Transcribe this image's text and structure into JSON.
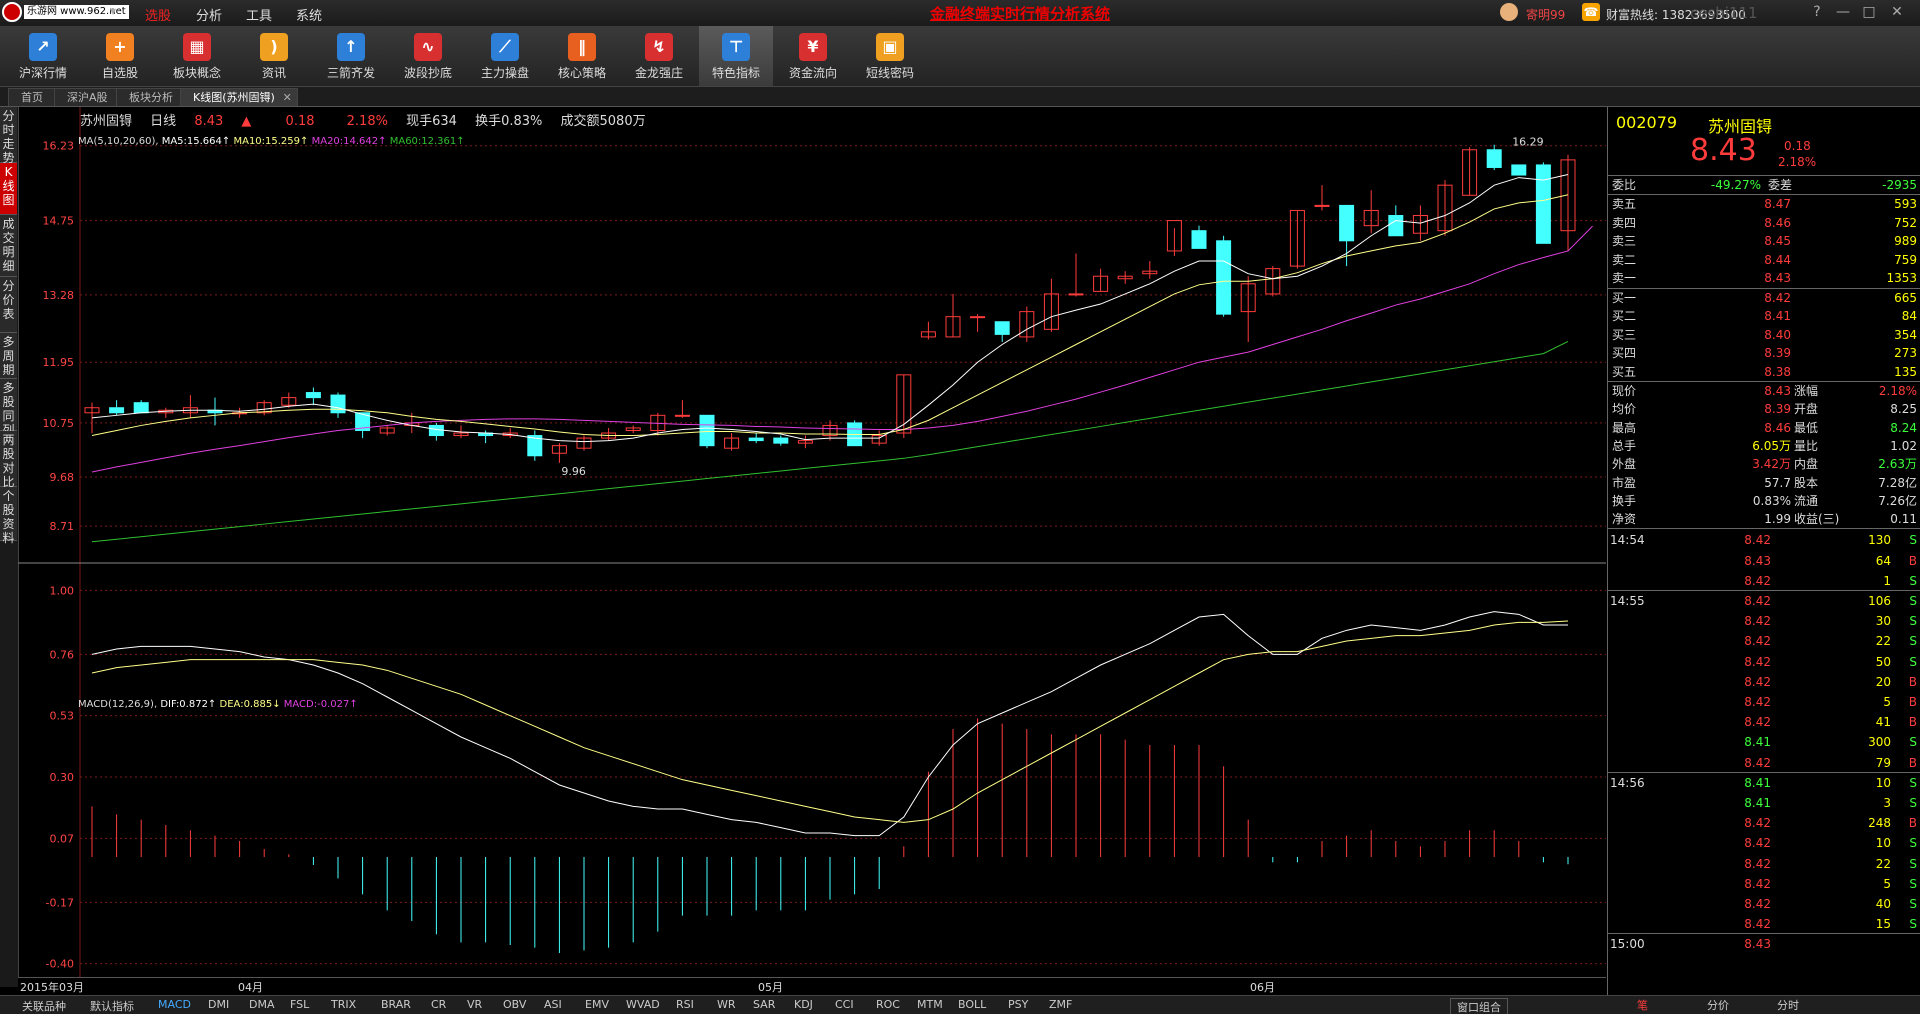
{
  "titlebar": {
    "logo_tag": "乐游网 www.962.net",
    "menus": [
      "选股",
      "分析",
      "工具",
      "系统"
    ],
    "marquee": "金融终端实时行情分析系统",
    "user_name": "寄明99",
    "hotline": "财富热线: 13823693500",
    "watermark": "ceshi111",
    "win_buttons": [
      "?",
      "—",
      "□",
      "✕"
    ]
  },
  "toolbar": [
    {
      "label": "沪深行情",
      "icon": "chart-icon",
      "color": "#2d7fd8",
      "glyph": "↗"
    },
    {
      "label": "自选股",
      "icon": "plus-icon",
      "color": "#f08020",
      "glyph": "+"
    },
    {
      "label": "板块概念",
      "icon": "grid-icon",
      "color": "#d83030",
      "glyph": "▦"
    },
    {
      "label": "资讯",
      "icon": "rss-icon",
      "color": "#f0a020",
      "glyph": ")"
    },
    {
      "label": "三箭齐发",
      "icon": "arrows-icon",
      "color": "#2d7fd8",
      "glyph": "↑"
    },
    {
      "label": "波段抄底",
      "icon": "wave-icon",
      "color": "#d83030",
      "glyph": "∿"
    },
    {
      "label": "主力操盘",
      "icon": "line-chart-icon",
      "color": "#2d7fd8",
      "glyph": "⟋"
    },
    {
      "label": "核心策略",
      "icon": "candle-icon",
      "color": "#e86020",
      "glyph": "‖"
    },
    {
      "label": "金龙强庄",
      "icon": "trend-icon",
      "color": "#d83030",
      "glyph": "↯"
    },
    {
      "label": "特色指标",
      "icon": "signpost-icon",
      "color": "#2d7fd8",
      "glyph": "⊤"
    },
    {
      "label": "资金流向",
      "icon": "money-icon",
      "color": "#d83030",
      "glyph": "¥"
    },
    {
      "label": "短线密码",
      "icon": "lock-icon",
      "color": "#f0a020",
      "glyph": "▣"
    }
  ],
  "tabs": [
    "首页",
    "深沪A股",
    "板块分析",
    "K线图(苏州固锝)"
  ],
  "sidebar": [
    "分时走势",
    "K线图",
    "成交明细",
    "分价表",
    "多周期",
    "多股同列",
    "两股对比",
    "个股资料"
  ],
  "stock": {
    "name": "苏州固锝",
    "period": "日线",
    "price": "8.43",
    "arrow": "▲",
    "change": "0.18",
    "pct": "2.18%",
    "volume_label": "现手634",
    "turnover_label": "换手0.83%",
    "amount_label": "成交额5080万"
  },
  "ma_legend": {
    "title": "MA(5,10,20,60)",
    "ma5": "MA5:15.664↑",
    "ma10": "MA10:15.259↑",
    "ma20": "MA20:14.642↑",
    "ma60": "MA60:12.361↑"
  },
  "macd_legend": {
    "title": "MACD(12,26,9)",
    "dif": "DIF:0.872↑",
    "dea": "DEA:0.885↓",
    "macd": "MACD:-0.027↑"
  },
  "colors": {
    "up": "#ff3c3c",
    "down": "#4ff",
    "ma5": "#ffffff",
    "ma10": "#ffff88",
    "ma20": "#e040e0",
    "ma60": "#30c030",
    "grid": "#7a1a1a"
  },
  "chart_data": [
    {
      "type": "candlestick",
      "title": "苏州固锝 日线",
      "y_ticks": [
        "16.23",
        "14.75",
        "13.28",
        "11.95",
        "10.75",
        "9.68",
        "8.71"
      ],
      "ylim": [
        8.0,
        16.6
      ],
      "annotations": [
        "16.29",
        "9.96"
      ],
      "candles": [
        [
          10.95,
          11.15,
          10.55,
          11.05
        ],
        [
          11.05,
          11.2,
          10.9,
          10.95
        ],
        [
          11.15,
          11.2,
          10.95,
          10.95
        ],
        [
          10.95,
          11.05,
          10.85,
          11.0
        ],
        [
          10.95,
          11.3,
          10.85,
          11.05
        ],
        [
          11.0,
          11.25,
          10.7,
          10.95
        ],
        [
          10.95,
          11.05,
          10.85,
          10.95
        ],
        [
          10.95,
          11.2,
          10.9,
          11.15
        ],
        [
          11.1,
          11.35,
          11.05,
          11.25
        ],
        [
          11.35,
          11.45,
          11.1,
          11.25
        ],
        [
          11.3,
          11.35,
          10.85,
          10.95
        ],
        [
          10.95,
          10.95,
          10.45,
          10.6
        ],
        [
          10.55,
          10.7,
          10.5,
          10.65
        ],
        [
          10.7,
          10.95,
          10.55,
          10.75
        ],
        [
          10.7,
          10.75,
          10.4,
          10.5
        ],
        [
          10.5,
          10.7,
          10.45,
          10.55
        ],
        [
          10.55,
          10.6,
          10.35,
          10.5
        ],
        [
          10.5,
          10.65,
          10.45,
          10.55
        ],
        [
          10.5,
          10.6,
          10.0,
          10.1
        ],
        [
          10.15,
          10.35,
          9.96,
          10.3
        ],
        [
          10.25,
          10.5,
          10.2,
          10.45
        ],
        [
          10.45,
          10.65,
          10.4,
          10.55
        ],
        [
          10.6,
          10.7,
          10.55,
          10.65
        ],
        [
          10.6,
          10.95,
          10.5,
          10.9
        ],
        [
          10.9,
          11.2,
          10.85,
          10.9
        ],
        [
          10.9,
          10.9,
          10.25,
          10.3
        ],
        [
          10.25,
          10.55,
          10.2,
          10.45
        ],
        [
          10.45,
          10.55,
          10.35,
          10.4
        ],
        [
          10.45,
          10.5,
          10.3,
          10.35
        ],
        [
          10.35,
          10.5,
          10.25,
          10.4
        ],
        [
          10.5,
          10.8,
          10.4,
          10.7
        ],
        [
          10.75,
          10.8,
          10.3,
          10.3
        ],
        [
          10.35,
          10.6,
          10.3,
          10.5
        ],
        [
          10.55,
          11.7,
          10.45,
          11.7
        ],
        [
          12.45,
          12.75,
          12.4,
          12.55
        ],
        [
          12.45,
          13.3,
          12.45,
          12.85
        ],
        [
          12.85,
          12.9,
          12.55,
          12.85
        ],
        [
          12.75,
          12.75,
          12.35,
          12.5
        ],
        [
          12.45,
          13.05,
          12.35,
          12.95
        ],
        [
          12.6,
          13.6,
          12.55,
          13.3
        ],
        [
          13.3,
          14.1,
          13.25,
          13.3
        ],
        [
          13.35,
          13.8,
          13.35,
          13.65
        ],
        [
          13.6,
          13.75,
          13.5,
          13.65
        ],
        [
          13.7,
          13.95,
          13.6,
          13.75
        ],
        [
          14.15,
          14.6,
          14.05,
          14.75
        ],
        [
          14.55,
          14.65,
          14.25,
          14.2
        ],
        [
          14.35,
          14.45,
          12.85,
          12.9
        ],
        [
          12.95,
          13.65,
          12.35,
          13.5
        ],
        [
          13.3,
          13.85,
          13.25,
          13.8
        ],
        [
          13.85,
          14.95,
          13.8,
          14.95
        ],
        [
          15.05,
          15.45,
          14.95,
          15.05
        ],
        [
          15.05,
          15.05,
          13.85,
          14.35
        ],
        [
          14.65,
          15.35,
          14.5,
          14.95
        ],
        [
          14.85,
          15.05,
          14.45,
          14.45
        ],
        [
          14.5,
          15.05,
          14.35,
          14.85
        ],
        [
          14.55,
          15.55,
          14.45,
          15.45
        ],
        [
          15.25,
          16.2,
          15.25,
          16.15
        ],
        [
          16.15,
          16.25,
          15.75,
          15.8
        ],
        [
          15.85,
          15.85,
          15.65,
          15.65
        ],
        [
          15.85,
          15.9,
          14.35,
          14.3
        ],
        [
          14.55,
          16.05,
          14.15,
          15.95
        ]
      ],
      "ma5": [
        10.85,
        10.9,
        10.95,
        10.98,
        11.0,
        11.0,
        10.98,
        11.02,
        11.08,
        11.12,
        11.05,
        10.92,
        10.8,
        10.7,
        10.62,
        10.57,
        10.55,
        10.52,
        10.45,
        10.4,
        10.38,
        10.4,
        10.45,
        10.55,
        10.62,
        10.65,
        10.62,
        10.58,
        10.53,
        10.42,
        10.45,
        10.45,
        10.45,
        10.72,
        11.1,
        11.5,
        11.95,
        12.3,
        12.6,
        12.85,
        12.98,
        13.1,
        13.3,
        13.5,
        13.75,
        13.95,
        13.95,
        13.7,
        13.6,
        13.65,
        13.85,
        14.1,
        14.45,
        14.75,
        14.7,
        14.85,
        15.1,
        15.45,
        15.6,
        15.55,
        15.66
      ],
      "ma10": [
        10.5,
        10.6,
        10.7,
        10.78,
        10.85,
        10.9,
        10.95,
        10.97,
        11.0,
        11.02,
        11.02,
        10.99,
        10.95,
        10.88,
        10.82,
        10.78,
        10.73,
        10.68,
        10.63,
        10.57,
        10.52,
        10.5,
        10.5,
        10.52,
        10.55,
        10.58,
        10.58,
        10.55,
        10.55,
        10.53,
        10.53,
        10.52,
        10.52,
        10.62,
        10.8,
        11.05,
        11.3,
        11.55,
        11.8,
        12.05,
        12.3,
        12.55,
        12.8,
        13.05,
        13.3,
        13.48,
        13.55,
        13.55,
        13.6,
        13.72,
        13.9,
        14.05,
        14.15,
        14.25,
        14.32,
        14.5,
        14.72,
        14.98,
        15.1,
        15.15,
        15.26
      ],
      "ma20": [
        9.78,
        9.88,
        9.97,
        10.06,
        10.15,
        10.23,
        10.3,
        10.38,
        10.46,
        10.53,
        10.6,
        10.65,
        10.7,
        10.75,
        10.78,
        10.8,
        10.82,
        10.83,
        10.83,
        10.82,
        10.8,
        10.78,
        10.76,
        10.74,
        10.72,
        10.71,
        10.7,
        10.68,
        10.67,
        10.65,
        10.64,
        10.63,
        10.62,
        10.62,
        10.65,
        10.7,
        10.78,
        10.88,
        10.98,
        11.1,
        11.22,
        11.36,
        11.5,
        11.65,
        11.8,
        11.95,
        12.05,
        12.15,
        12.3,
        12.45,
        12.6,
        12.77,
        12.92,
        13.08,
        13.2,
        13.35,
        13.5,
        13.7,
        13.88,
        14.02,
        14.15,
        14.64
      ],
      "ma60": [
        8.4,
        8.45,
        8.5,
        8.55,
        8.6,
        8.65,
        8.7,
        8.75,
        8.8,
        8.85,
        8.9,
        8.95,
        9.0,
        9.05,
        9.1,
        9.15,
        9.2,
        9.25,
        9.3,
        9.35,
        9.4,
        9.45,
        9.5,
        9.55,
        9.6,
        9.65,
        9.7,
        9.75,
        9.8,
        9.85,
        9.9,
        9.95,
        10.0,
        10.05,
        10.12,
        10.2,
        10.28,
        10.36,
        10.44,
        10.52,
        10.6,
        10.68,
        10.76,
        10.84,
        10.92,
        11.0,
        11.08,
        11.16,
        11.24,
        11.32,
        11.4,
        11.48,
        11.56,
        11.64,
        11.72,
        11.8,
        11.88,
        11.96,
        12.04,
        12.12,
        12.36
      ]
    },
    {
      "type": "bar",
      "title": "MACD(12,26,9)",
      "y_ticks": [
        "1.00",
        "0.76",
        "0.53",
        "0.30",
        "0.07",
        "-0.17",
        "-0.40"
      ],
      "ylim": [
        -0.45,
        1.05
      ],
      "dif": [
        0.76,
        0.78,
        0.79,
        0.79,
        0.79,
        0.78,
        0.77,
        0.75,
        0.74,
        0.72,
        0.69,
        0.65,
        0.6,
        0.55,
        0.5,
        0.45,
        0.41,
        0.37,
        0.32,
        0.27,
        0.24,
        0.21,
        0.19,
        0.18,
        0.18,
        0.16,
        0.14,
        0.13,
        0.11,
        0.09,
        0.09,
        0.08,
        0.08,
        0.15,
        0.3,
        0.42,
        0.5,
        0.54,
        0.58,
        0.62,
        0.67,
        0.72,
        0.76,
        0.8,
        0.85,
        0.9,
        0.91,
        0.83,
        0.76,
        0.76,
        0.82,
        0.85,
        0.87,
        0.86,
        0.85,
        0.87,
        0.9,
        0.92,
        0.91,
        0.87,
        0.87
      ],
      "dea": [
        0.69,
        0.71,
        0.72,
        0.73,
        0.74,
        0.74,
        0.74,
        0.74,
        0.74,
        0.74,
        0.73,
        0.72,
        0.7,
        0.67,
        0.64,
        0.61,
        0.57,
        0.53,
        0.49,
        0.45,
        0.41,
        0.38,
        0.35,
        0.32,
        0.29,
        0.27,
        0.25,
        0.23,
        0.21,
        0.19,
        0.17,
        0.15,
        0.14,
        0.13,
        0.14,
        0.18,
        0.24,
        0.29,
        0.34,
        0.39,
        0.44,
        0.49,
        0.54,
        0.59,
        0.64,
        0.69,
        0.74,
        0.76,
        0.77,
        0.77,
        0.79,
        0.81,
        0.82,
        0.83,
        0.83,
        0.84,
        0.85,
        0.87,
        0.88,
        0.88,
        0.885
      ],
      "macd": [
        0.19,
        0.16,
        0.14,
        0.12,
        0.1,
        0.08,
        0.06,
        0.03,
        0.01,
        -0.03,
        -0.08,
        -0.14,
        -0.2,
        -0.24,
        -0.29,
        -0.32,
        -0.32,
        -0.33,
        -0.34,
        -0.36,
        -0.35,
        -0.34,
        -0.32,
        -0.28,
        -0.22,
        -0.22,
        -0.22,
        -0.2,
        -0.2,
        -0.2,
        -0.16,
        -0.14,
        -0.12,
        0.04,
        0.32,
        0.48,
        0.52,
        0.5,
        0.48,
        0.46,
        0.46,
        0.46,
        0.44,
        0.42,
        0.42,
        0.42,
        0.34,
        0.14,
        -0.02,
        -0.02,
        0.06,
        0.08,
        0.1,
        0.06,
        0.04,
        0.06,
        0.1,
        0.1,
        0.06,
        -0.02,
        -0.027
      ]
    }
  ],
  "date_axis": [
    "2015年03月",
    "04月",
    "05月",
    "06月"
  ],
  "bottom_tabs": [
    "关联品种",
    "默认指标",
    "MACD",
    "DMI",
    "DMA",
    "FSL",
    "TRIX",
    "BRAR",
    "CR",
    "VR",
    "OBV",
    "ASI",
    "EMV",
    "WVAD",
    "RSI",
    "WR",
    "SAR",
    "KDJ",
    "CCI",
    "ROC",
    "MTM",
    "BOLL",
    "PSY",
    "ZMF"
  ],
  "window_combo": "窗口组合",
  "right_panel": {
    "code": "002079",
    "name": "苏州固锝",
    "price": "8.43",
    "change": "0.18",
    "pct": "2.18%",
    "weibi": {
      "label": "委比",
      "value": "-49.27%",
      "label2": "委差",
      "value2": "-2935"
    },
    "asks": [
      {
        "label": "卖五",
        "price": "8.47",
        "vol": "593"
      },
      {
        "label": "卖四",
        "price": "8.46",
        "vol": "752"
      },
      {
        "label": "卖三",
        "price": "8.45",
        "vol": "989"
      },
      {
        "label": "卖二",
        "price": "8.44",
        "vol": "759"
      },
      {
        "label": "卖一",
        "price": "8.43",
        "vol": "1353"
      }
    ],
    "bids": [
      {
        "label": "买一",
        "price": "8.42",
        "vol": "665"
      },
      {
        "label": "买二",
        "price": "8.41",
        "vol": "84"
      },
      {
        "label": "买三",
        "price": "8.40",
        "vol": "354"
      },
      {
        "label": "买四",
        "price": "8.39",
        "vol": "273"
      },
      {
        "label": "买五",
        "price": "8.38",
        "vol": "135"
      }
    ],
    "stats": [
      {
        "l1": "现价",
        "v1": "8.43",
        "c1": "red",
        "l2": "涨幅",
        "v2": "2.18%",
        "c2": "red"
      },
      {
        "l1": "均价",
        "v1": "8.39",
        "c1": "red",
        "l2": "开盘",
        "v2": "8.25",
        "c2": "white"
      },
      {
        "l1": "最高",
        "v1": "8.46",
        "c1": "red",
        "l2": "最低",
        "v2": "8.24",
        "c2": "green"
      },
      {
        "l1": "总手",
        "v1": "6.05万",
        "c1": "yellow",
        "l2": "量比",
        "v2": "1.02",
        "c2": "white"
      },
      {
        "l1": "外盘",
        "v1": "3.42万",
        "c1": "red",
        "l2": "内盘",
        "v2": "2.63万",
        "c2": "green"
      },
      {
        "l1": "市盈",
        "v1": "57.7",
        "c1": "white",
        "l2": "股本",
        "v2": "7.28亿",
        "c2": "white"
      },
      {
        "l1": "换手",
        "v1": "0.83%",
        "c1": "white",
        "l2": "流通",
        "v2": "7.26亿",
        "c2": "white"
      },
      {
        "l1": "净资",
        "v1": "1.99",
        "c1": "white",
        "l2": "收益(三)",
        "v2": "0.11",
        "c2": "white"
      }
    ],
    "ticks": [
      {
        "t": "14:54",
        "p": "8.42",
        "v": "130",
        "d": "S"
      },
      {
        "t": "",
        "p": "8.43",
        "v": "64",
        "d": "B"
      },
      {
        "t": "",
        "p": "8.42",
        "v": "1",
        "d": "S"
      },
      {
        "t": "14:55",
        "p": "8.42",
        "v": "106",
        "d": "S"
      },
      {
        "t": "",
        "p": "8.42",
        "v": "30",
        "d": "S"
      },
      {
        "t": "",
        "p": "8.42",
        "v": "22",
        "d": "S"
      },
      {
        "t": "",
        "p": "8.42",
        "v": "50",
        "d": "S"
      },
      {
        "t": "",
        "p": "8.42",
        "v": "20",
        "d": "B"
      },
      {
        "t": "",
        "p": "8.42",
        "v": "5",
        "d": "B"
      },
      {
        "t": "",
        "p": "8.42",
        "v": "41",
        "d": "B"
      },
      {
        "t": "",
        "p": "8.41",
        "v": "300",
        "d": "S"
      },
      {
        "t": "",
        "p": "8.42",
        "v": "79",
        "d": "B"
      },
      {
        "t": "14:56",
        "p": "8.41",
        "v": "10",
        "d": "S"
      },
      {
        "t": "",
        "p": "8.41",
        "v": "3",
        "d": "S"
      },
      {
        "t": "",
        "p": "8.42",
        "v": "248",
        "d": "B"
      },
      {
        "t": "",
        "p": "8.42",
        "v": "10",
        "d": "S"
      },
      {
        "t": "",
        "p": "8.42",
        "v": "22",
        "d": "S"
      },
      {
        "t": "",
        "p": "8.42",
        "v": "5",
        "d": "S"
      },
      {
        "t": "",
        "p": "8.42",
        "v": "40",
        "d": "S"
      },
      {
        "t": "",
        "p": "8.42",
        "v": "15",
        "d": "S"
      },
      {
        "t": "15:00",
        "p": "8.43",
        "v": "",
        "d": ""
      }
    ],
    "bottom_tabs": [
      "笔",
      "分价",
      "分时"
    ]
  }
}
